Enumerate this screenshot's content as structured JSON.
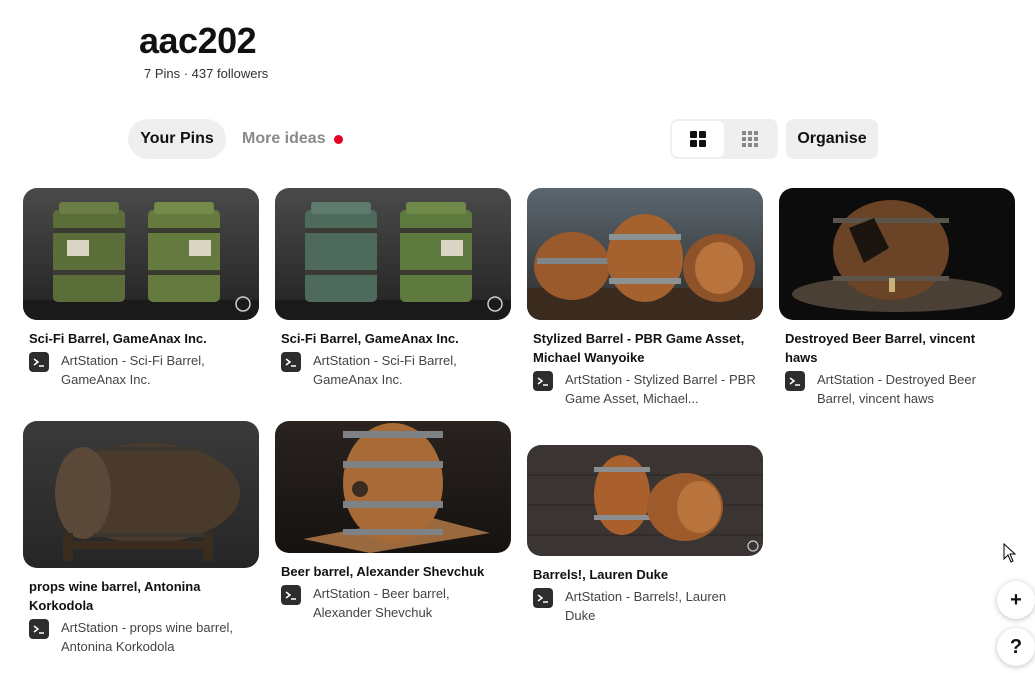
{
  "board": {
    "title": "aac202",
    "meta": "7 Pins · 437 followers"
  },
  "tabs": {
    "your_pins": "Your Pins",
    "more_ideas": "More ideas"
  },
  "toolbar": {
    "organise": "Organise",
    "view_default_icon": "grid-2x2-icon",
    "view_compact_icon": "grid-3x3-icon"
  },
  "pins": [
    {
      "title": "Sci-Fi Barrel, GameAnax Inc.",
      "source": "ArtStation - Sci-Fi Barrel, GameAnax Inc.",
      "image": "green sci-fi barrel render",
      "source_icon": "terminal-icon"
    },
    {
      "title": "Sci-Fi Barrel, GameAnax Inc.",
      "source": "ArtStation - Sci-Fi Barrel, GameAnax Inc.",
      "image": "green and blue sci-fi barrel render",
      "source_icon": "terminal-icon"
    },
    {
      "title": "Stylized Barrel - PBR Game Asset, Michael Wanyoike",
      "source": "ArtStation - Stylized Barrel - PBR Game Asset, Michael...",
      "image": "three stylized wooden barrels",
      "source_icon": "terminal-icon"
    },
    {
      "title": "Destroyed Beer Barrel, vincent haws",
      "source": "ArtStation - Destroyed Beer Barrel, vincent haws",
      "image": "broken wooden barrel on dark ground",
      "source_icon": "terminal-icon"
    },
    {
      "title": "props wine barrel, Antonina Korkodola",
      "source": "ArtStation - props wine barrel, Antonina Korkodola",
      "image": "wine barrel on wooden stand",
      "source_icon": "terminal-icon"
    },
    {
      "title": "Beer barrel, Alexander Shevchuk",
      "source": "ArtStation - Beer barrel, Alexander Shevchuk",
      "image": "beer barrel with tap on wooden board",
      "source_icon": "terminal-icon"
    },
    {
      "title": "Barrels!, Lauren Duke",
      "source": "ArtStation - Barrels!, Lauren Duke",
      "image": "two barrels on brick floor",
      "source_icon": "terminal-icon"
    }
  ],
  "colors": {
    "accent_dot": "#e60023",
    "pill_bg": "#efefef"
  },
  "fabs": {
    "add": "+",
    "help": "?"
  }
}
